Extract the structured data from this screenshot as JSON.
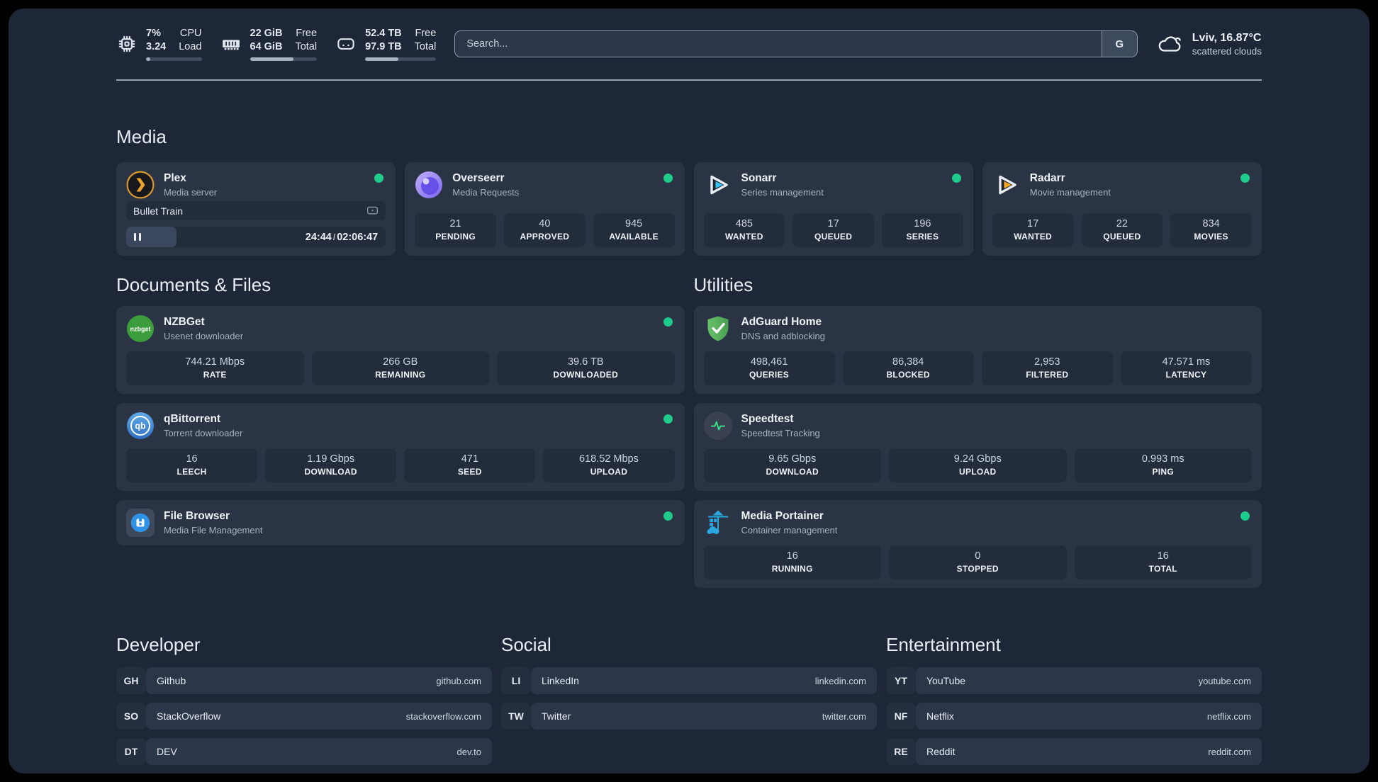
{
  "colors": {
    "panel-bg": "#1d2737",
    "card-bg": "#2a3444",
    "stat-bg": "#222c3b",
    "accent-green": "#1ecb8a"
  },
  "header": {
    "metrics": [
      {
        "icon": "cpu-icon",
        "value_top": "7%",
        "value_bottom": "3.24",
        "label_top": "CPU",
        "label_bottom": "Load",
        "progress_pct": 8
      },
      {
        "icon": "memory-icon",
        "value_top": "22 GiB",
        "value_bottom": "64 GiB",
        "label_top": "Free",
        "label_bottom": "Total",
        "progress_pct": 65
      },
      {
        "icon": "disk-icon",
        "value_top": "52.4 TB",
        "value_bottom": "97.9 TB",
        "label_top": "Free",
        "label_bottom": "Total",
        "progress_pct": 47
      }
    ],
    "search": {
      "placeholder": "Search...",
      "engine_button": "G"
    },
    "weather": {
      "location_temp": "Lviv, 16.87°C",
      "condition": "scattered clouds"
    }
  },
  "sections": {
    "media": {
      "title": "Media",
      "plex": {
        "title": "Plex",
        "subtitle": "Media server",
        "now_playing": "Bullet Train",
        "position": "24:44",
        "separator": "/",
        "duration": "02:06:47",
        "progress_pct": 19.5
      },
      "overseerr": {
        "title": "Overseerr",
        "subtitle": "Media Requests",
        "stats": [
          {
            "value": "21",
            "label": "PENDING"
          },
          {
            "value": "40",
            "label": "APPROVED"
          },
          {
            "value": "945",
            "label": "AVAILABLE"
          }
        ]
      },
      "sonarr": {
        "title": "Sonarr",
        "subtitle": "Series management",
        "stats": [
          {
            "value": "485",
            "label": "WANTED"
          },
          {
            "value": "17",
            "label": "QUEUED"
          },
          {
            "value": "196",
            "label": "SERIES"
          }
        ]
      },
      "radarr": {
        "title": "Radarr",
        "subtitle": "Movie management",
        "stats": [
          {
            "value": "17",
            "label": "WANTED"
          },
          {
            "value": "22",
            "label": "QUEUED"
          },
          {
            "value": "834",
            "label": "MOVIES"
          }
        ]
      }
    },
    "documents": {
      "title": "Documents & Files",
      "nzbget": {
        "title": "NZBGet",
        "subtitle": "Usenet downloader",
        "stats": [
          {
            "value": "744.21 Mbps",
            "label": "RATE"
          },
          {
            "value": "266 GB",
            "label": "REMAINING"
          },
          {
            "value": "39.6 TB",
            "label": "DOWNLOADED"
          }
        ]
      },
      "qbittorrent": {
        "title": "qBittorrent",
        "subtitle": "Torrent downloader",
        "stats": [
          {
            "value": "16",
            "label": "LEECH"
          },
          {
            "value": "1.19 Gbps",
            "label": "DOWNLOAD"
          },
          {
            "value": "471",
            "label": "SEED"
          },
          {
            "value": "618.52 Mbps",
            "label": "UPLOAD"
          }
        ]
      },
      "filebrowser": {
        "title": "File Browser",
        "subtitle": "Media File Management"
      }
    },
    "utilities": {
      "title": "Utilities",
      "adguard": {
        "title": "AdGuard Home",
        "subtitle": "DNS and adblocking",
        "stats": [
          {
            "value": "498,461",
            "label": "QUERIES"
          },
          {
            "value": "86,384",
            "label": "BLOCKED"
          },
          {
            "value": "2,953",
            "label": "FILTERED"
          },
          {
            "value": "47.571 ms",
            "label": "LATENCY"
          }
        ]
      },
      "speedtest": {
        "title": "Speedtest",
        "subtitle": "Speedtest Tracking",
        "stats": [
          {
            "value": "9.65 Gbps",
            "label": "DOWNLOAD"
          },
          {
            "value": "9.24 Gbps",
            "label": "UPLOAD"
          },
          {
            "value": "0.993 ms",
            "label": "PING"
          }
        ]
      },
      "portainer": {
        "title": "Media Portainer",
        "subtitle": "Container management",
        "stats": [
          {
            "value": "16",
            "label": "RUNNING"
          },
          {
            "value": "0",
            "label": "STOPPED"
          },
          {
            "value": "16",
            "label": "TOTAL"
          }
        ]
      }
    },
    "developer": {
      "title": "Developer",
      "links": [
        {
          "tag": "GH",
          "name": "Github",
          "url": "github.com"
        },
        {
          "tag": "SO",
          "name": "StackOverflow",
          "url": "stackoverflow.com"
        },
        {
          "tag": "DT",
          "name": "DEV",
          "url": "dev.to"
        }
      ]
    },
    "social": {
      "title": "Social",
      "links": [
        {
          "tag": "LI",
          "name": "LinkedIn",
          "url": "linkedin.com"
        },
        {
          "tag": "TW",
          "name": "Twitter",
          "url": "twitter.com"
        }
      ]
    },
    "entertainment": {
      "title": "Entertainment",
      "links": [
        {
          "tag": "YT",
          "name": "YouTube",
          "url": "youtube.com"
        },
        {
          "tag": "NF",
          "name": "Netflix",
          "url": "netflix.com"
        },
        {
          "tag": "RE",
          "name": "Reddit",
          "url": "reddit.com"
        }
      ]
    }
  },
  "icons": {
    "nzbget_text": "nzbget",
    "qbittorrent_text": "qb"
  }
}
